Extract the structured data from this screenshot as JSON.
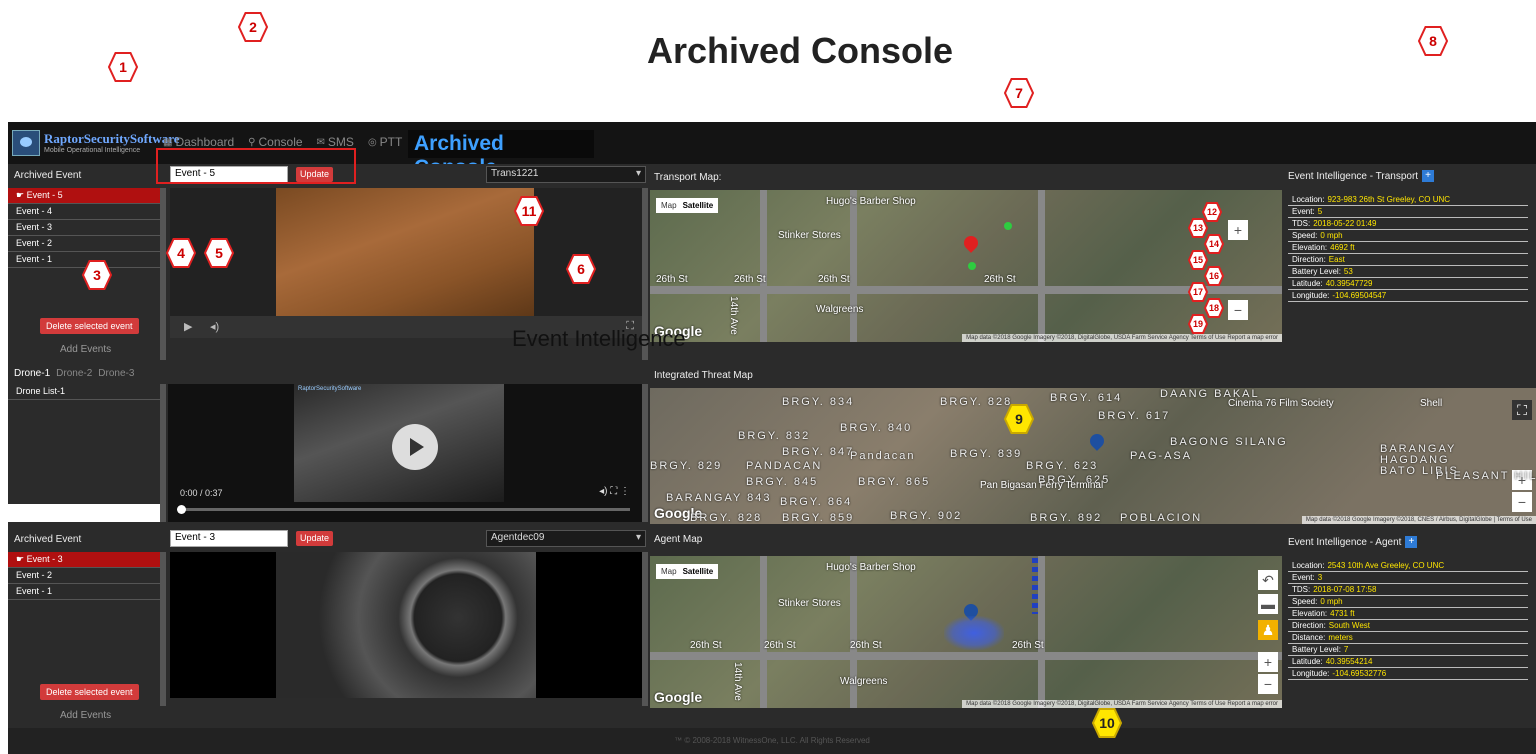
{
  "page_heading": "Archived Console",
  "brand": {
    "name": "RaptorSecuritySoftware",
    "subtitle": "Mobile Operational Intelligence"
  },
  "nav": {
    "items": [
      {
        "label": "Dashboard",
        "icon": "dashboard-icon"
      },
      {
        "label": "Console",
        "icon": "console-icon"
      },
      {
        "label": "SMS",
        "icon": "sms-icon"
      },
      {
        "label": "PTT",
        "icon": "ptt-icon"
      }
    ],
    "power_icon": "power-icon",
    "console_title": "Archived Console"
  },
  "transport_panel": {
    "header": "Archived Event",
    "events": [
      "Event - 5",
      "Event - 4",
      "Event - 3",
      "Event - 2",
      "Event - 1"
    ],
    "selected_index": 0,
    "event_input_value": "Event - 5",
    "update_label": "Update",
    "device_select": "Trans1221",
    "delete_label": "Delete selected event",
    "add_label": "Add Events"
  },
  "drone_panel": {
    "tabs": [
      "Drone-1",
      "Drone-2",
      "Drone-3"
    ],
    "active_tab": 0,
    "list_item": "Drone List-1",
    "time": "0:00 / 0:37",
    "watermark": "RaptorSecuritySoftware"
  },
  "agent_panel": {
    "header": "Archived Event",
    "events": [
      "Event - 3",
      "Event - 2",
      "Event - 1"
    ],
    "selected_index": 0,
    "event_input_value": "Event - 3",
    "update_label": "Update",
    "device_select": "Agentdec09",
    "delete_label": "Delete selected event",
    "add_label": "Add Events"
  },
  "transport_map": {
    "title": "Transport Map:",
    "map_toggle": {
      "map": "Map",
      "satellite": "Satellite"
    },
    "labels": [
      "Hugo's Barber Shop",
      "Stinker Stores",
      "26th St",
      "26th St",
      "26th St",
      "26th St",
      "Walgreens",
      "14th Ave"
    ],
    "google": "Google",
    "attribution": "Map data ©2018 Google Imagery ©2018, DigitalGlobe, USDA Farm Service Agency   Terms of Use   Report a map error"
  },
  "transport_intel": {
    "title": "Event Intelligence - Transport",
    "rows": [
      {
        "k": "Location:",
        "v": "923-983 26th St Greeley, CO UNC"
      },
      {
        "k": "Event:",
        "v": "5"
      },
      {
        "k": "TDS:",
        "v": "2018-05-22 01:49"
      },
      {
        "k": "Speed:",
        "v": "0 mph"
      },
      {
        "k": "Elevation:",
        "v": "4692 ft"
      },
      {
        "k": "Direction:",
        "v": "East"
      },
      {
        "k": "Battery Level:",
        "v": "53"
      },
      {
        "k": "Latitude:",
        "v": "40.39547729"
      },
      {
        "k": "Longitude:",
        "v": "-104.69504547"
      }
    ]
  },
  "threat_map": {
    "title": "Integrated Threat Map",
    "labels": [
      "BRGY. 834",
      "BRGY. 828",
      "BRGY. 614",
      "BRGY. 617",
      "DAANG BAKAL",
      "BRGY. 832",
      "BRGY. 840",
      "BRGY. 847",
      "Pandacan",
      "BRGY. 839",
      "BRGY. 829",
      "PANDACAN",
      "BRGY. 845",
      "BRGY. 865",
      "BRGY. 625",
      "BRGY. 623",
      "BAGONG SILANG",
      "PAG-ASA",
      "BARANGAY 843",
      "BRGY. 864",
      "BRGY. 828",
      "BRGY. 859",
      "BRGY. 902",
      "BRGY. 892",
      "POBLACION",
      "BARANGAY HAGDANG BATO LIBIS",
      "PLEASANT HILLS"
    ],
    "places": [
      "Cinema 76 Film Society",
      "Shell",
      "Pan Bigasan Ferry Terminal"
    ],
    "google": "Google",
    "attribution": "Map data ©2018 Google Imagery ©2018, CNES / Airbus, DigitalGlobe | Terms of Use"
  },
  "agent_map": {
    "title": "Agent Map",
    "map_toggle": {
      "map": "Map",
      "satellite": "Satellite"
    },
    "labels": [
      "Hugo's Barber Shop",
      "Stinker Stores",
      "26th St",
      "26th St",
      "26th St",
      "26th St",
      "Walgreens",
      "14th Ave"
    ],
    "google": "Google",
    "attribution": "Map data ©2018 Google Imagery ©2018, DigitalGlobe, USDA Farm Service Agency   Terms of Use   Report a map error"
  },
  "agent_intel": {
    "title": "Event Intelligence - Agent",
    "rows": [
      {
        "k": "Location:",
        "v": "2543 10th Ave Greeley, CO UNC"
      },
      {
        "k": "Event:",
        "v": "3"
      },
      {
        "k": "TDS:",
        "v": "2018-07-08 17:58"
      },
      {
        "k": "Speed:",
        "v": "0 mph"
      },
      {
        "k": "Elevation:",
        "v": "4731 ft"
      },
      {
        "k": "Direction:",
        "v": "South West"
      },
      {
        "k": "Distance:",
        "v": "meters"
      },
      {
        "k": "Battery Level:",
        "v": "7"
      },
      {
        "k": "Latitude:",
        "v": "40.39554214"
      },
      {
        "k": "Longitude:",
        "v": "-104.69532776"
      }
    ]
  },
  "overlay_text": "Event Intelligence",
  "footer": "™ © 2008-2018 WitnessOne, LLC. All Rights Reserved",
  "callouts": [
    "1",
    "2",
    "3",
    "4",
    "5",
    "6",
    "7",
    "8",
    "9",
    "10",
    "11",
    "12",
    "13",
    "14",
    "15",
    "16",
    "17",
    "18",
    "19"
  ],
  "colors": {
    "accent_red": "#e02020",
    "title_blue": "#3ea0ff",
    "value_yellow": "#ffe600",
    "selected_event": "#b01010"
  }
}
